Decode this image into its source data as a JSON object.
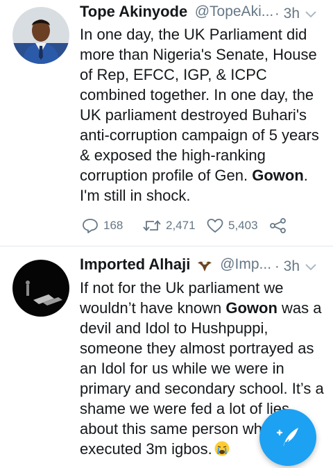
{
  "tweets": [
    {
      "author_name": "Tope Akinyode",
      "handle": "@TopeAki...",
      "time": "· 3h",
      "text_before": "In one day, the UK Parliament did more than Nigeria's Senate, House of Rep, EFCC, IGP, & ICPC combined together. In one day, the UK parliament destroyed Buhari's anti-corruption campaign of 5 years & exposed the high-ranking corruption profile of Gen. ",
      "text_bold": "Gowon",
      "text_after": ". I'm still in shock.",
      "replies": "168",
      "retweets": "2,471",
      "likes": "5,403"
    },
    {
      "author_name": "Imported Alhaji",
      "name_emoji_icon": "eagle-emoji-icon",
      "handle": "@Imp...",
      "time": "· 3h",
      "text_before": "If not for the Uk parliament we wouldn’t have known ",
      "text_bold": "Gowon",
      "text_after": " was a devil and Idol to Hushpuppi, someone they almost portrayed as an Idol for us while we were in primary and secondary school. It’s a shame we were fed a lot of lies about this same person who executed 3m igbos.",
      "text_emoji_icon": "crying-face-emoji-icon"
    }
  ],
  "icons": {
    "reply": "reply-icon",
    "retweet": "retweet-icon",
    "like": "heart-icon",
    "share": "share-icon",
    "more": "chevron-down-icon",
    "compose": "compose-tweet-icon"
  },
  "colors": {
    "accent": "#1da1f2",
    "text": "#14171a",
    "secondary_text": "#657786",
    "divider": "#e1e8ed"
  }
}
